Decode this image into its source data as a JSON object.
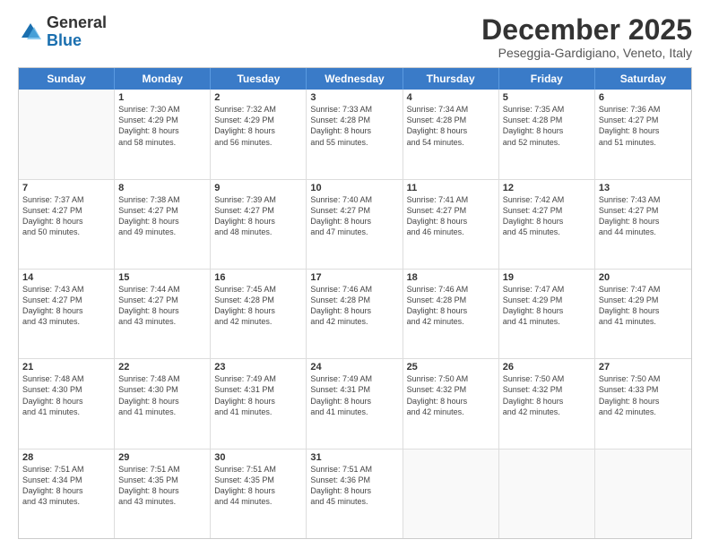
{
  "logo": {
    "general": "General",
    "blue": "Blue"
  },
  "title": "December 2025",
  "location": "Peseggia-Gardigiano, Veneto, Italy",
  "days": [
    "Sunday",
    "Monday",
    "Tuesday",
    "Wednesday",
    "Thursday",
    "Friday",
    "Saturday"
  ],
  "weeks": [
    [
      {
        "day": "",
        "data": []
      },
      {
        "day": "1",
        "data": [
          "Sunrise: 7:30 AM",
          "Sunset: 4:29 PM",
          "Daylight: 8 hours",
          "and 58 minutes."
        ]
      },
      {
        "day": "2",
        "data": [
          "Sunrise: 7:32 AM",
          "Sunset: 4:29 PM",
          "Daylight: 8 hours",
          "and 56 minutes."
        ]
      },
      {
        "day": "3",
        "data": [
          "Sunrise: 7:33 AM",
          "Sunset: 4:28 PM",
          "Daylight: 8 hours",
          "and 55 minutes."
        ]
      },
      {
        "day": "4",
        "data": [
          "Sunrise: 7:34 AM",
          "Sunset: 4:28 PM",
          "Daylight: 8 hours",
          "and 54 minutes."
        ]
      },
      {
        "day": "5",
        "data": [
          "Sunrise: 7:35 AM",
          "Sunset: 4:28 PM",
          "Daylight: 8 hours",
          "and 52 minutes."
        ]
      },
      {
        "day": "6",
        "data": [
          "Sunrise: 7:36 AM",
          "Sunset: 4:27 PM",
          "Daylight: 8 hours",
          "and 51 minutes."
        ]
      }
    ],
    [
      {
        "day": "7",
        "data": [
          "Sunrise: 7:37 AM",
          "Sunset: 4:27 PM",
          "Daylight: 8 hours",
          "and 50 minutes."
        ]
      },
      {
        "day": "8",
        "data": [
          "Sunrise: 7:38 AM",
          "Sunset: 4:27 PM",
          "Daylight: 8 hours",
          "and 49 minutes."
        ]
      },
      {
        "day": "9",
        "data": [
          "Sunrise: 7:39 AM",
          "Sunset: 4:27 PM",
          "Daylight: 8 hours",
          "and 48 minutes."
        ]
      },
      {
        "day": "10",
        "data": [
          "Sunrise: 7:40 AM",
          "Sunset: 4:27 PM",
          "Daylight: 8 hours",
          "and 47 minutes."
        ]
      },
      {
        "day": "11",
        "data": [
          "Sunrise: 7:41 AM",
          "Sunset: 4:27 PM",
          "Daylight: 8 hours",
          "and 46 minutes."
        ]
      },
      {
        "day": "12",
        "data": [
          "Sunrise: 7:42 AM",
          "Sunset: 4:27 PM",
          "Daylight: 8 hours",
          "and 45 minutes."
        ]
      },
      {
        "day": "13",
        "data": [
          "Sunrise: 7:43 AM",
          "Sunset: 4:27 PM",
          "Daylight: 8 hours",
          "and 44 minutes."
        ]
      }
    ],
    [
      {
        "day": "14",
        "data": [
          "Sunrise: 7:43 AM",
          "Sunset: 4:27 PM",
          "Daylight: 8 hours",
          "and 43 minutes."
        ]
      },
      {
        "day": "15",
        "data": [
          "Sunrise: 7:44 AM",
          "Sunset: 4:27 PM",
          "Daylight: 8 hours",
          "and 43 minutes."
        ]
      },
      {
        "day": "16",
        "data": [
          "Sunrise: 7:45 AM",
          "Sunset: 4:28 PM",
          "Daylight: 8 hours",
          "and 42 minutes."
        ]
      },
      {
        "day": "17",
        "data": [
          "Sunrise: 7:46 AM",
          "Sunset: 4:28 PM",
          "Daylight: 8 hours",
          "and 42 minutes."
        ]
      },
      {
        "day": "18",
        "data": [
          "Sunrise: 7:46 AM",
          "Sunset: 4:28 PM",
          "Daylight: 8 hours",
          "and 42 minutes."
        ]
      },
      {
        "day": "19",
        "data": [
          "Sunrise: 7:47 AM",
          "Sunset: 4:29 PM",
          "Daylight: 8 hours",
          "and 41 minutes."
        ]
      },
      {
        "day": "20",
        "data": [
          "Sunrise: 7:47 AM",
          "Sunset: 4:29 PM",
          "Daylight: 8 hours",
          "and 41 minutes."
        ]
      }
    ],
    [
      {
        "day": "21",
        "data": [
          "Sunrise: 7:48 AM",
          "Sunset: 4:30 PM",
          "Daylight: 8 hours",
          "and 41 minutes."
        ]
      },
      {
        "day": "22",
        "data": [
          "Sunrise: 7:48 AM",
          "Sunset: 4:30 PM",
          "Daylight: 8 hours",
          "and 41 minutes."
        ]
      },
      {
        "day": "23",
        "data": [
          "Sunrise: 7:49 AM",
          "Sunset: 4:31 PM",
          "Daylight: 8 hours",
          "and 41 minutes."
        ]
      },
      {
        "day": "24",
        "data": [
          "Sunrise: 7:49 AM",
          "Sunset: 4:31 PM",
          "Daylight: 8 hours",
          "and 41 minutes."
        ]
      },
      {
        "day": "25",
        "data": [
          "Sunrise: 7:50 AM",
          "Sunset: 4:32 PM",
          "Daylight: 8 hours",
          "and 42 minutes."
        ]
      },
      {
        "day": "26",
        "data": [
          "Sunrise: 7:50 AM",
          "Sunset: 4:32 PM",
          "Daylight: 8 hours",
          "and 42 minutes."
        ]
      },
      {
        "day": "27",
        "data": [
          "Sunrise: 7:50 AM",
          "Sunset: 4:33 PM",
          "Daylight: 8 hours",
          "and 42 minutes."
        ]
      }
    ],
    [
      {
        "day": "28",
        "data": [
          "Sunrise: 7:51 AM",
          "Sunset: 4:34 PM",
          "Daylight: 8 hours",
          "and 43 minutes."
        ]
      },
      {
        "day": "29",
        "data": [
          "Sunrise: 7:51 AM",
          "Sunset: 4:35 PM",
          "Daylight: 8 hours",
          "and 43 minutes."
        ]
      },
      {
        "day": "30",
        "data": [
          "Sunrise: 7:51 AM",
          "Sunset: 4:35 PM",
          "Daylight: 8 hours",
          "and 44 minutes."
        ]
      },
      {
        "day": "31",
        "data": [
          "Sunrise: 7:51 AM",
          "Sunset: 4:36 PM",
          "Daylight: 8 hours",
          "and 45 minutes."
        ]
      },
      {
        "day": "",
        "data": []
      },
      {
        "day": "",
        "data": []
      },
      {
        "day": "",
        "data": []
      }
    ]
  ]
}
